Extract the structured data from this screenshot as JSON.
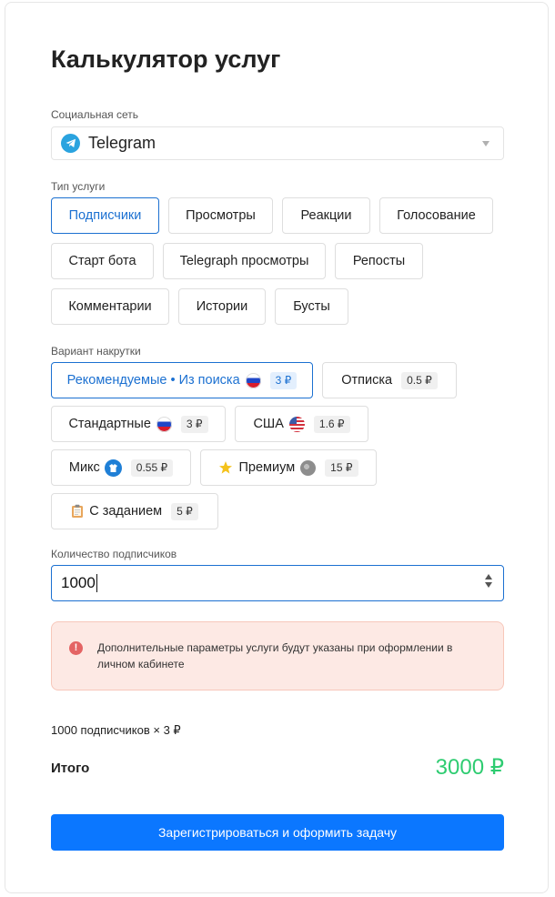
{
  "title": "Калькулятор услуг",
  "social": {
    "label": "Социальная сеть",
    "value": "Telegram",
    "icon": "telegram-icon"
  },
  "service_type": {
    "label": "Тип услуги",
    "options": [
      "Подписчики",
      "Просмотры",
      "Реакции",
      "Голосование",
      "Старт бота",
      "Telegraph просмотры",
      "Репосты",
      "Комментарии",
      "Истории",
      "Бусты"
    ],
    "selected": "Подписчики"
  },
  "variant": {
    "label": "Вариант накрутки",
    "options": [
      {
        "label": "Рекомендуемые • Из поиска",
        "price": "3 ₽",
        "icon": "russia-flag-icon",
        "selected": true
      },
      {
        "label": "Отписка",
        "price": "0.5 ₽"
      },
      {
        "label": "Стандартные",
        "price": "3 ₽",
        "icon": "russia-flag-icon"
      },
      {
        "label": "США",
        "price": "1.6 ₽",
        "icon": "usa-flag-icon"
      },
      {
        "label": "Микс",
        "price": "0.55 ₽",
        "icon": "mix-icon"
      },
      {
        "label": "Премиум",
        "price": "15 ₽",
        "icon": "globe-icon",
        "prefix_icon": "star-icon"
      },
      {
        "label": "С заданием",
        "price": "5 ₽",
        "prefix_icon": "clipboard-icon"
      }
    ]
  },
  "quantity": {
    "label": "Количество подписчиков",
    "value": "1000"
  },
  "alert": {
    "text": "Дополнительные параметры услуги будут указаны при оформлении в личном кабинете"
  },
  "summary": {
    "formula": "1000 подписчиков × 3 ₽",
    "total_label": "Итого",
    "total_value": "3000 ₽"
  },
  "submit_label": "Зарегистрироваться и оформить задачу",
  "colors": {
    "accent": "#1b70d1",
    "button": "#0b77ff",
    "total": "#2ecc71",
    "alert_bg": "#fde9e4"
  }
}
